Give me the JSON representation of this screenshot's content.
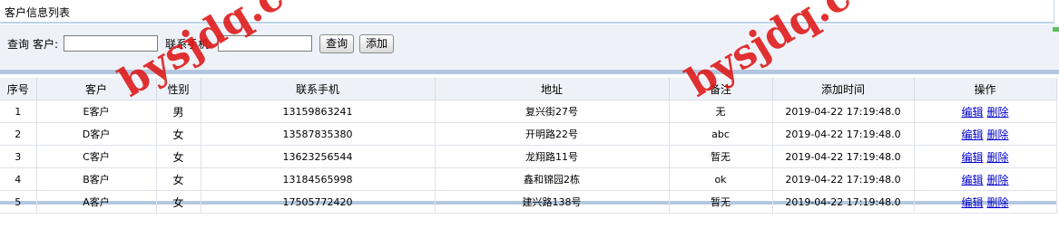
{
  "page": {
    "title": "客户信息列表"
  },
  "search": {
    "query_label": "查询",
    "customer_label": "客户:",
    "customer_value": "",
    "phone_label": "联系手机:",
    "phone_value": "",
    "search_button": "查询",
    "add_button": "添加"
  },
  "table": {
    "headers": [
      "序号",
      "客户",
      "性别",
      "联系手机",
      "地址",
      "备注",
      "添加时间",
      "操作"
    ],
    "rows": [
      {
        "no": "1",
        "customer": "E客户",
        "gender": "男",
        "phone": "13159863241",
        "address": "复兴街27号",
        "note": "无",
        "time": "2019-04-22 17:19:48.0",
        "edit": "编辑",
        "delete": "删除"
      },
      {
        "no": "2",
        "customer": "D客户",
        "gender": "女",
        "phone": "13587835380",
        "address": "开明路22号",
        "note": "abc",
        "time": "2019-04-22 17:19:48.0",
        "edit": "编辑",
        "delete": "删除"
      },
      {
        "no": "3",
        "customer": "C客户",
        "gender": "女",
        "phone": "13623256544",
        "address": "龙翔路11号",
        "note": "暂无",
        "time": "2019-04-22 17:19:48.0",
        "edit": "编辑",
        "delete": "删除"
      },
      {
        "no": "4",
        "customer": "B客户",
        "gender": "女",
        "phone": "13184565998",
        "address": "鑫和锦园2栋",
        "note": "ok",
        "time": "2019-04-22 17:19:48.0",
        "edit": "编辑",
        "delete": "删除"
      },
      {
        "no": "5",
        "customer": "A客户",
        "gender": "女",
        "phone": "17505772420",
        "address": "建兴路138号",
        "note": "暂无",
        "time": "2019-04-22 17:19:48.0",
        "edit": "编辑",
        "delete": "删除"
      }
    ]
  },
  "watermark": {
    "text": "bysjdq.com(毕业设计大全)"
  },
  "colors": {
    "panel_bg": "#eef2f8",
    "panel_border": "#b3c8e0",
    "link": "#0000cc",
    "watermark": "#de1414",
    "accent_mark": "#5cc05c"
  }
}
